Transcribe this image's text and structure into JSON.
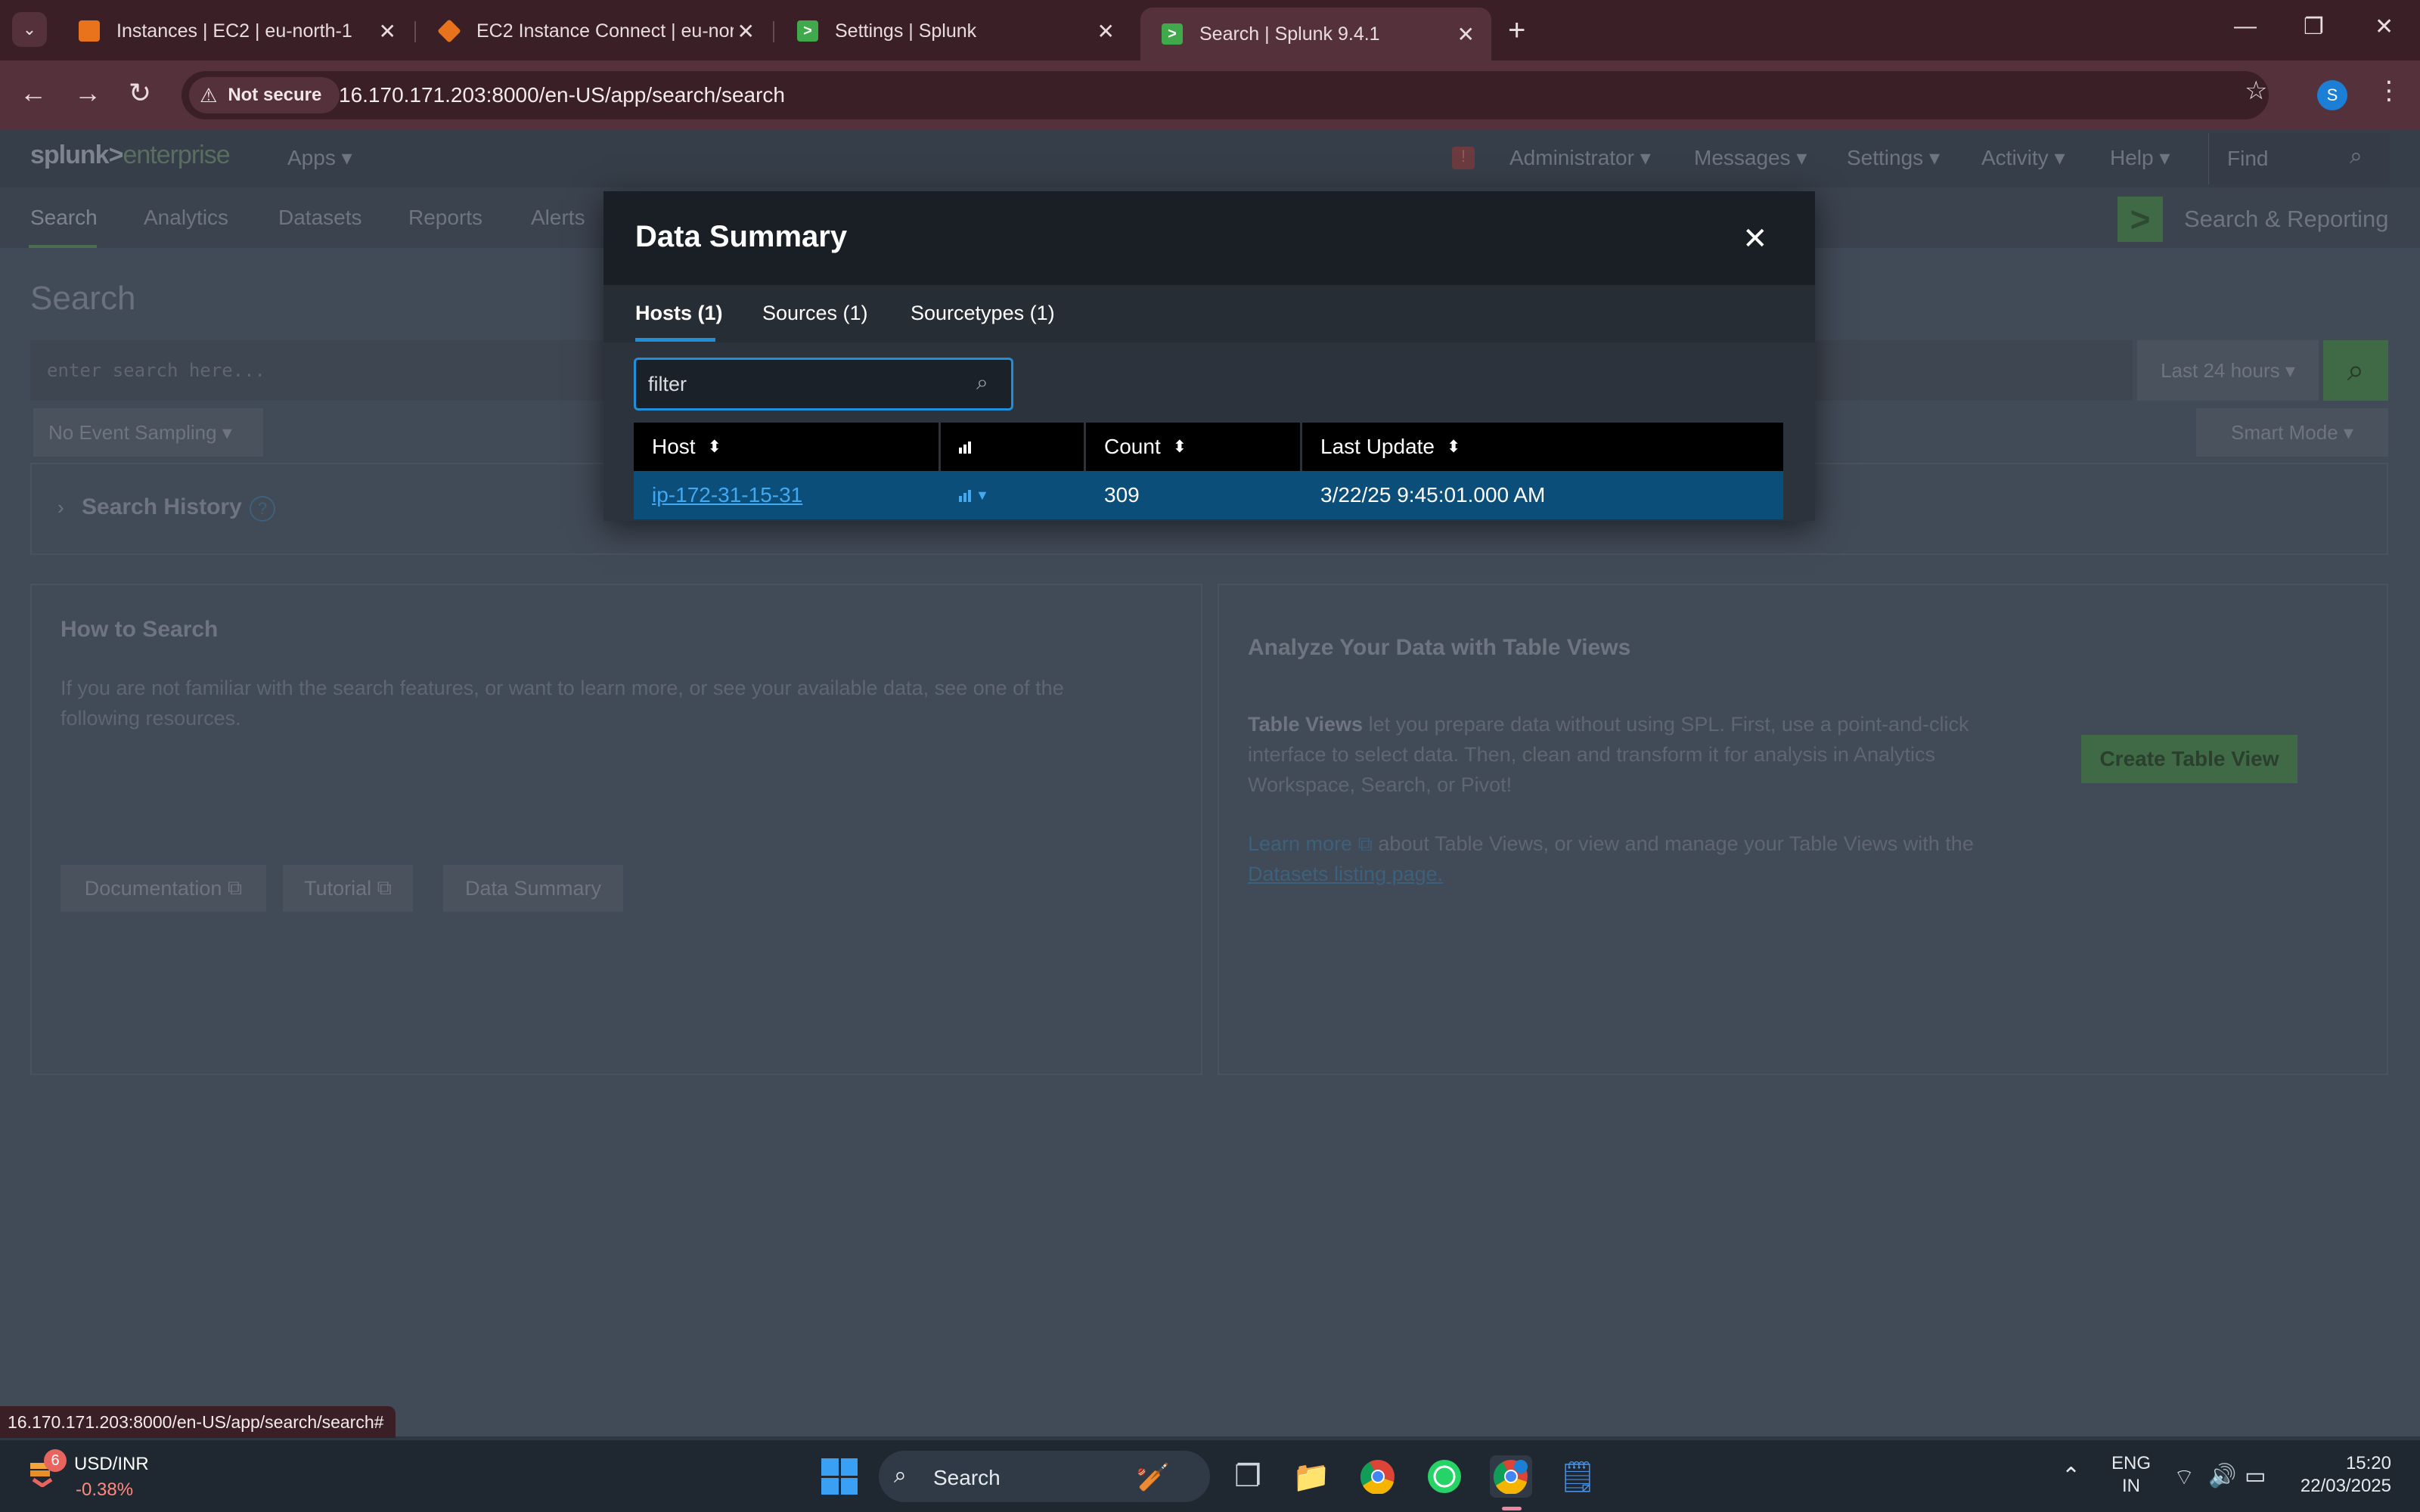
{
  "browser": {
    "tabs": [
      {
        "label": "Instances | EC2 | eu-north-1",
        "icon": "aws-ec2-icon",
        "color": "#e8731c"
      },
      {
        "label": "EC2 Instance Connect | eu-nort",
        "icon": "aws-ec2-icon",
        "color": "#e8731c"
      },
      {
        "label": "Settings | Splunk",
        "icon": "splunk-icon",
        "color": "#3fa94b"
      },
      {
        "label": "Search | Splunk 9.4.1",
        "icon": "splunk-icon",
        "color": "#3fa94b"
      }
    ],
    "active_tab": 3,
    "security_label": "Not secure",
    "url": "16.170.171.203:8000/en-US/app/search/search",
    "profile_initial": "S"
  },
  "splunk": {
    "logo_main": "splunk>",
    "logo_sub": "enterprise",
    "header": {
      "apps": "Apps ▾",
      "admin": "Administrator ▾",
      "messages": "Messages ▾",
      "settings": "Settings ▾",
      "activity": "Activity ▾",
      "help": "Help ▾",
      "find_placeholder": "Find"
    },
    "nav": [
      "Search",
      "Analytics",
      "Datasets",
      "Reports",
      "Alerts"
    ],
    "app_title": "Search & Reporting",
    "page_title": "Search",
    "search_placeholder": "enter search here...",
    "time_range": "Last 24 hours ▾",
    "sampling": "No Event Sampling ▾",
    "mode": "Smart Mode ▾",
    "history_label": "Search History",
    "how_to": {
      "title": "How to Search",
      "text": "If you are not familiar with the search features, or want to learn more, or see your available data, see one of the following resources.",
      "buttons": [
        "Documentation",
        "Tutorial",
        "Data Summary"
      ]
    },
    "table_views": {
      "title": "Analyze Your Data with Table Views",
      "lead": "Table Views",
      "text": " let you prepare data without using SPL. First, use a point-and-click interface to select data. Then, clean and transform it for analysis in Analytics Workspace, Search, or Pivot!",
      "learn_more": "Learn more",
      "text2": " about Table Views, or view and manage your Table Views with the",
      "datasets_link": "Datasets listing page.",
      "create_button": "Create Table View"
    }
  },
  "modal": {
    "title": "Data Summary",
    "tabs": [
      "Hosts (1)",
      "Sources (1)",
      "Sourcetypes (1)"
    ],
    "active_tab": 0,
    "filter_value": "filter",
    "columns": [
      "Host",
      "",
      "Count",
      "Last Update"
    ],
    "rows": [
      {
        "host": "ip-172-31-15-31",
        "count": "309",
        "last_update": "3/22/25 9:45:01.000 AM"
      }
    ]
  },
  "status_url": "16.170.171.203:8000/en-US/app/search/search#",
  "taskbar": {
    "widget_badge": "6",
    "widget_title": "USD/INR",
    "widget_value": "-0.38%",
    "search_label": "Search",
    "lang1": "ENG",
    "lang2": "IN",
    "time": "15:20",
    "date": "22/03/2025"
  }
}
